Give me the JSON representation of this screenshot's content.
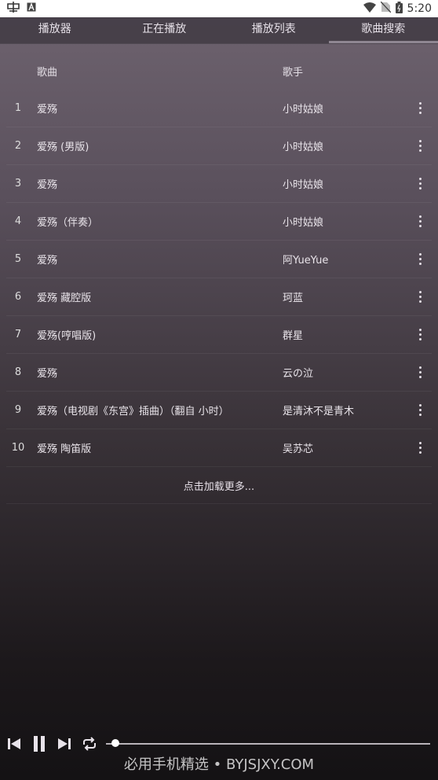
{
  "status_bar": {
    "time": "5:20",
    "icons": [
      "app-icon",
      "a-icon",
      "wifi-icon",
      "no-sim-icon",
      "battery-icon"
    ]
  },
  "tabs": [
    {
      "label": "播放器"
    },
    {
      "label": "正在播放"
    },
    {
      "label": "播放列表"
    },
    {
      "label": "歌曲搜索",
      "active": true
    }
  ],
  "table": {
    "header": {
      "song": "歌曲",
      "artist": "歌手"
    },
    "rows": [
      {
        "num": "1",
        "song": "爱殇",
        "artist": "小时姑娘"
      },
      {
        "num": "2",
        "song": "爱殇 (男版)",
        "artist": "小时姑娘"
      },
      {
        "num": "3",
        "song": "爱殇",
        "artist": "小时姑娘"
      },
      {
        "num": "4",
        "song": "爱殇（伴奏）",
        "artist": "小时姑娘"
      },
      {
        "num": "5",
        "song": "爱殇",
        "artist": "阿YueYue"
      },
      {
        "num": "6",
        "song": "爱殇 藏腔版",
        "artist": "珂蓝"
      },
      {
        "num": "7",
        "song": "爱殇(哼唱版)",
        "artist": "群星"
      },
      {
        "num": "8",
        "song": "爱殇",
        "artist": "云の泣"
      },
      {
        "num": "9",
        "song": "爱殇（电视剧《东宫》插曲）（翻自 小时）",
        "artist": "是清沐不是青木"
      },
      {
        "num": "10",
        "song": "爱殇 陶笛版",
        "artist": "吴苏芯"
      }
    ]
  },
  "load_more": "点击加载更多...",
  "player": {
    "progress": 0.02
  },
  "watermark": "必用手机精选 • BYJSJXY.COM"
}
